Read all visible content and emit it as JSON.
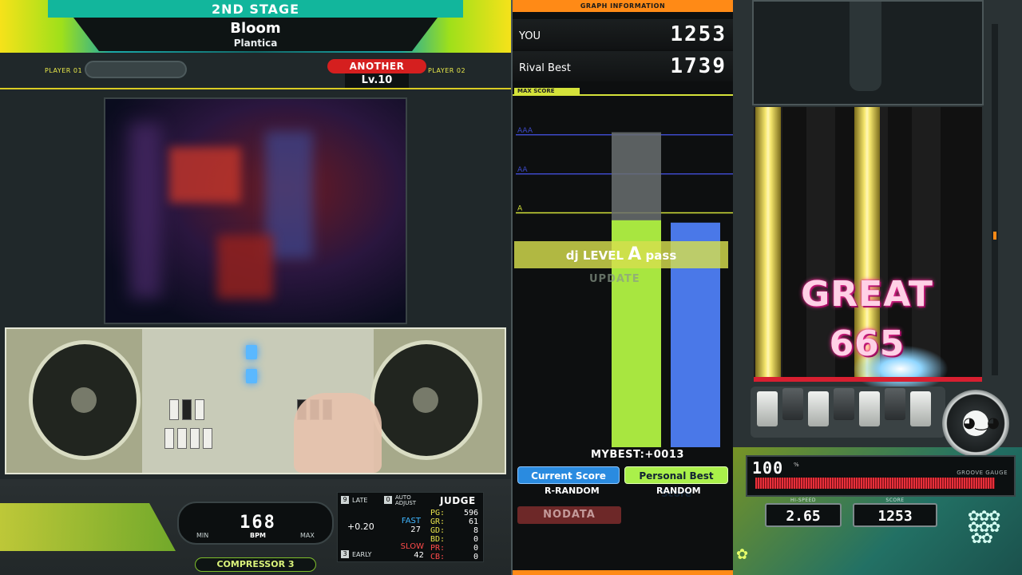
{
  "header": {
    "stage": "2ND STAGE",
    "song_title": "Bloom",
    "artist": "Plantica",
    "player1_label": "PLAYER 01",
    "player2_label": "PLAYER 02",
    "difficulty": "ANOTHER",
    "level": "Lv.10"
  },
  "bpm_panel": {
    "min_label": "MIN",
    "max_label": "MAX",
    "bpm_value": "168",
    "bpm_label": "BPM",
    "effector": "COMPRESSOR 3"
  },
  "judge_panel": {
    "title": "JUDGE",
    "late_label": "LATE",
    "early_label": "EARLY",
    "auto_adjust_label": "AUTO ADJUST",
    "late_icon": "9",
    "auto_icon": "0",
    "early_icon": "3",
    "timing_offset": "+0.20",
    "fast_label": "FAST",
    "fast_value": "27",
    "slow_label": "SLOW",
    "slow_value": "42",
    "rows": [
      {
        "key": "PG:",
        "value": "596"
      },
      {
        "key": "GR:",
        "value": "61"
      },
      {
        "key": "GD:",
        "value": "8"
      },
      {
        "key": "BD:",
        "value": "0"
      },
      {
        "key": "PR:",
        "value": "0"
      },
      {
        "key": "CB:",
        "value": "0"
      }
    ]
  },
  "graph": {
    "header": "GRAPH INFORMATION",
    "you_label": "YOU",
    "you_score": "1253",
    "rival_label": "Rival Best",
    "rival_score": "1739",
    "max_score_label": "MAX SCORE",
    "grade_lines": [
      {
        "label": "AAA",
        "color": "#3d49c8"
      },
      {
        "label": "AA",
        "color": "#3d49c8"
      },
      {
        "label": "A",
        "color": "#d4e23a"
      }
    ],
    "dj_level_prefix": "dj LEVEL",
    "dj_level_grade": "A",
    "dj_level_suffix": "pass",
    "update_label": "UPDATE",
    "mybest": "MYBEST:+0013",
    "current_score_label": "Current Score",
    "personal_best_label": "Personal Best Score",
    "current_option": "R-RANDOM",
    "personal_best_option": "RANDOM",
    "nodata_label": "NODATA",
    "colors": {
      "current": "#a8e640",
      "personal_best": "#4a78e8",
      "target": "#6a6f70"
    }
  },
  "chart_data": {
    "type": "bar",
    "categories": [
      "Current Score",
      "Personal Best Score"
    ],
    "series": [
      {
        "name": "Current Score",
        "values": [
          1253
        ]
      },
      {
        "name": "Personal Best Score",
        "values": [
          1240
        ]
      }
    ],
    "target_value": 1739,
    "ylim": [
      0,
      1940
    ],
    "grade_thresholds": {
      "AAA": 1725,
      "AA": 1509,
      "A": 1294
    }
  },
  "play_field": {
    "judge_text": "GREAT",
    "combo": "665",
    "gauge_percent": "100",
    "gauge_percent_unit": "%",
    "gauge_label": "GROOVE GAUGE",
    "gauge_fill": 1.0,
    "hispeed_label": "HI-SPEED",
    "hispeed_value": "2.65",
    "score_label": "SCORE",
    "score_value": "1253",
    "scratch_face": "◕‿◕"
  },
  "icons": {
    "logo": "flower-logo-icon",
    "bottom_left": "flower-small-icon"
  }
}
